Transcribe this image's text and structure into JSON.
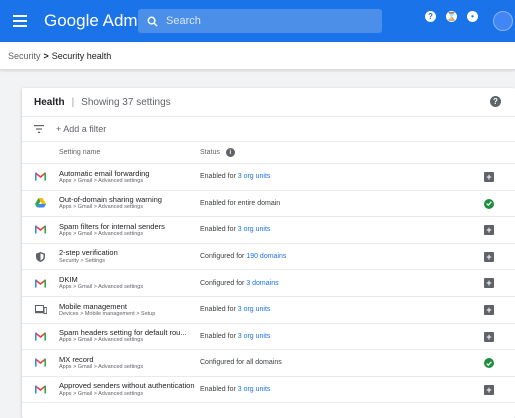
{
  "topbar": {
    "brand": "Google Admin",
    "search_placeholder": "Search",
    "color": "#1a73e8"
  },
  "breadcrumb": {
    "parent": "Security",
    "separator": ">",
    "current": "Security health"
  },
  "card": {
    "title": "Health",
    "divider": "|",
    "count_text": "Showing 37 settings",
    "add_filter": "+ Add a filter",
    "col_name": "Setting name",
    "col_status": "Status"
  },
  "rows": [
    {
      "icon": "gmail-icon",
      "title": "Automatic email forwarding",
      "path": "Apps > Gmail > Advanced settings",
      "status_prefix": "Enabled for ",
      "status_link": "3 org units",
      "action": "plus"
    },
    {
      "icon": "drive-icon",
      "title": "Out-of-domain sharing warning",
      "path": "Apps > Gmail > Advanced settings",
      "status_prefix": "Enabled for entire domain",
      "status_link": "",
      "action": "check"
    },
    {
      "icon": "gmail-icon",
      "title": "Spam filters for internal senders",
      "path": "Apps > Gmail > Advanced settings",
      "status_prefix": "Enabled for ",
      "status_link": "3 org units",
      "action": "plus"
    },
    {
      "icon": "shield-icon",
      "title": "2-step verification",
      "path": "Security > Settings",
      "status_prefix": "Configured for ",
      "status_link": "190 domains",
      "action": "plus"
    },
    {
      "icon": "gmail-icon",
      "title": "DKIM",
      "path": "Apps > Gmail > Advanced settings",
      "status_prefix": "Configured for ",
      "status_link": "3 domains",
      "action": "plus"
    },
    {
      "icon": "devices-icon",
      "title": "Mobile management",
      "path": "Devices > Mobile management > Setup",
      "status_prefix": "Enabled for ",
      "status_link": "3 org units",
      "action": "plus"
    },
    {
      "icon": "gmail-icon",
      "title": "Spam headers setting for default rou...",
      "path": "Apps > Gmail > Advanced settings",
      "status_prefix": "Enabled for ",
      "status_link": "3 org units",
      "action": "plus"
    },
    {
      "icon": "gmail-icon",
      "title": "MX record",
      "path": "Apps > Gmail > Advanced settings",
      "status_prefix": "Configured for all domains",
      "status_link": "",
      "action": "check"
    },
    {
      "icon": "gmail-icon",
      "title": "Approved senders without authentication",
      "path": "Apps > Gmail > Advanced settings",
      "status_prefix": "Enabled for ",
      "status_link": "3 org units",
      "action": "plus"
    }
  ]
}
